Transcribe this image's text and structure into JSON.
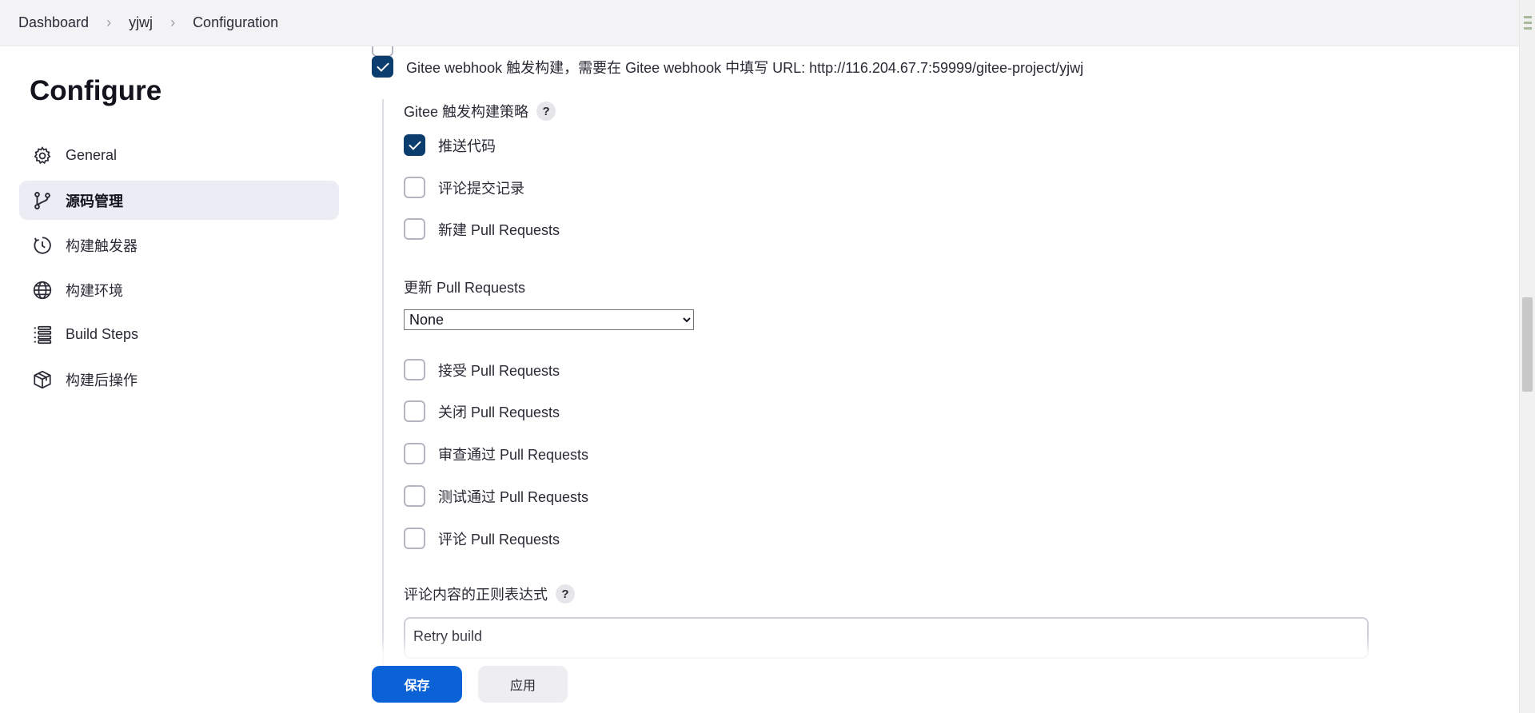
{
  "breadcrumb": {
    "items": [
      "Dashboard",
      "yjwj",
      "Configuration"
    ]
  },
  "sidebar": {
    "title": "Configure",
    "items": [
      {
        "label": "General",
        "icon": "gear-icon",
        "active": false
      },
      {
        "label": "源码管理",
        "icon": "branch-icon",
        "active": true
      },
      {
        "label": "构建触发器",
        "icon": "clock-icon",
        "active": false
      },
      {
        "label": "构建环境",
        "icon": "globe-icon",
        "active": false
      },
      {
        "label": "Build Steps",
        "icon": "list-icon",
        "active": false
      },
      {
        "label": "构建后操作",
        "icon": "package-icon",
        "active": false
      }
    ]
  },
  "form": {
    "webhook_label": "Gitee webhook 触发构建，需要在 Gitee webhook 中填写 URL: http://116.204.67.7:59999/gitee-project/yjwj",
    "strategy_label": "Gitee 触发构建策略",
    "push_code": "推送代码",
    "comment_commit": "评论提交记录",
    "new_pr": "新建 Pull Requests",
    "update_pr_label": "更新 Pull Requests",
    "update_pr_value": "None",
    "accept_pr": "接受 Pull Requests",
    "close_pr": "关闭 Pull Requests",
    "approve_pr": "审查通过 Pull Requests",
    "test_pr": "测试通过 Pull Requests",
    "comment_pr": "评论 Pull Requests",
    "regex_label": "评论内容的正则表达式",
    "regex_value": "Retry build",
    "help": "?"
  },
  "actions": {
    "save": "保存",
    "apply": "应用"
  },
  "colors": {
    "accent": "#0b62d6",
    "checkbox_checked": "#0b3d6e",
    "active_nav": "#ececf5"
  }
}
